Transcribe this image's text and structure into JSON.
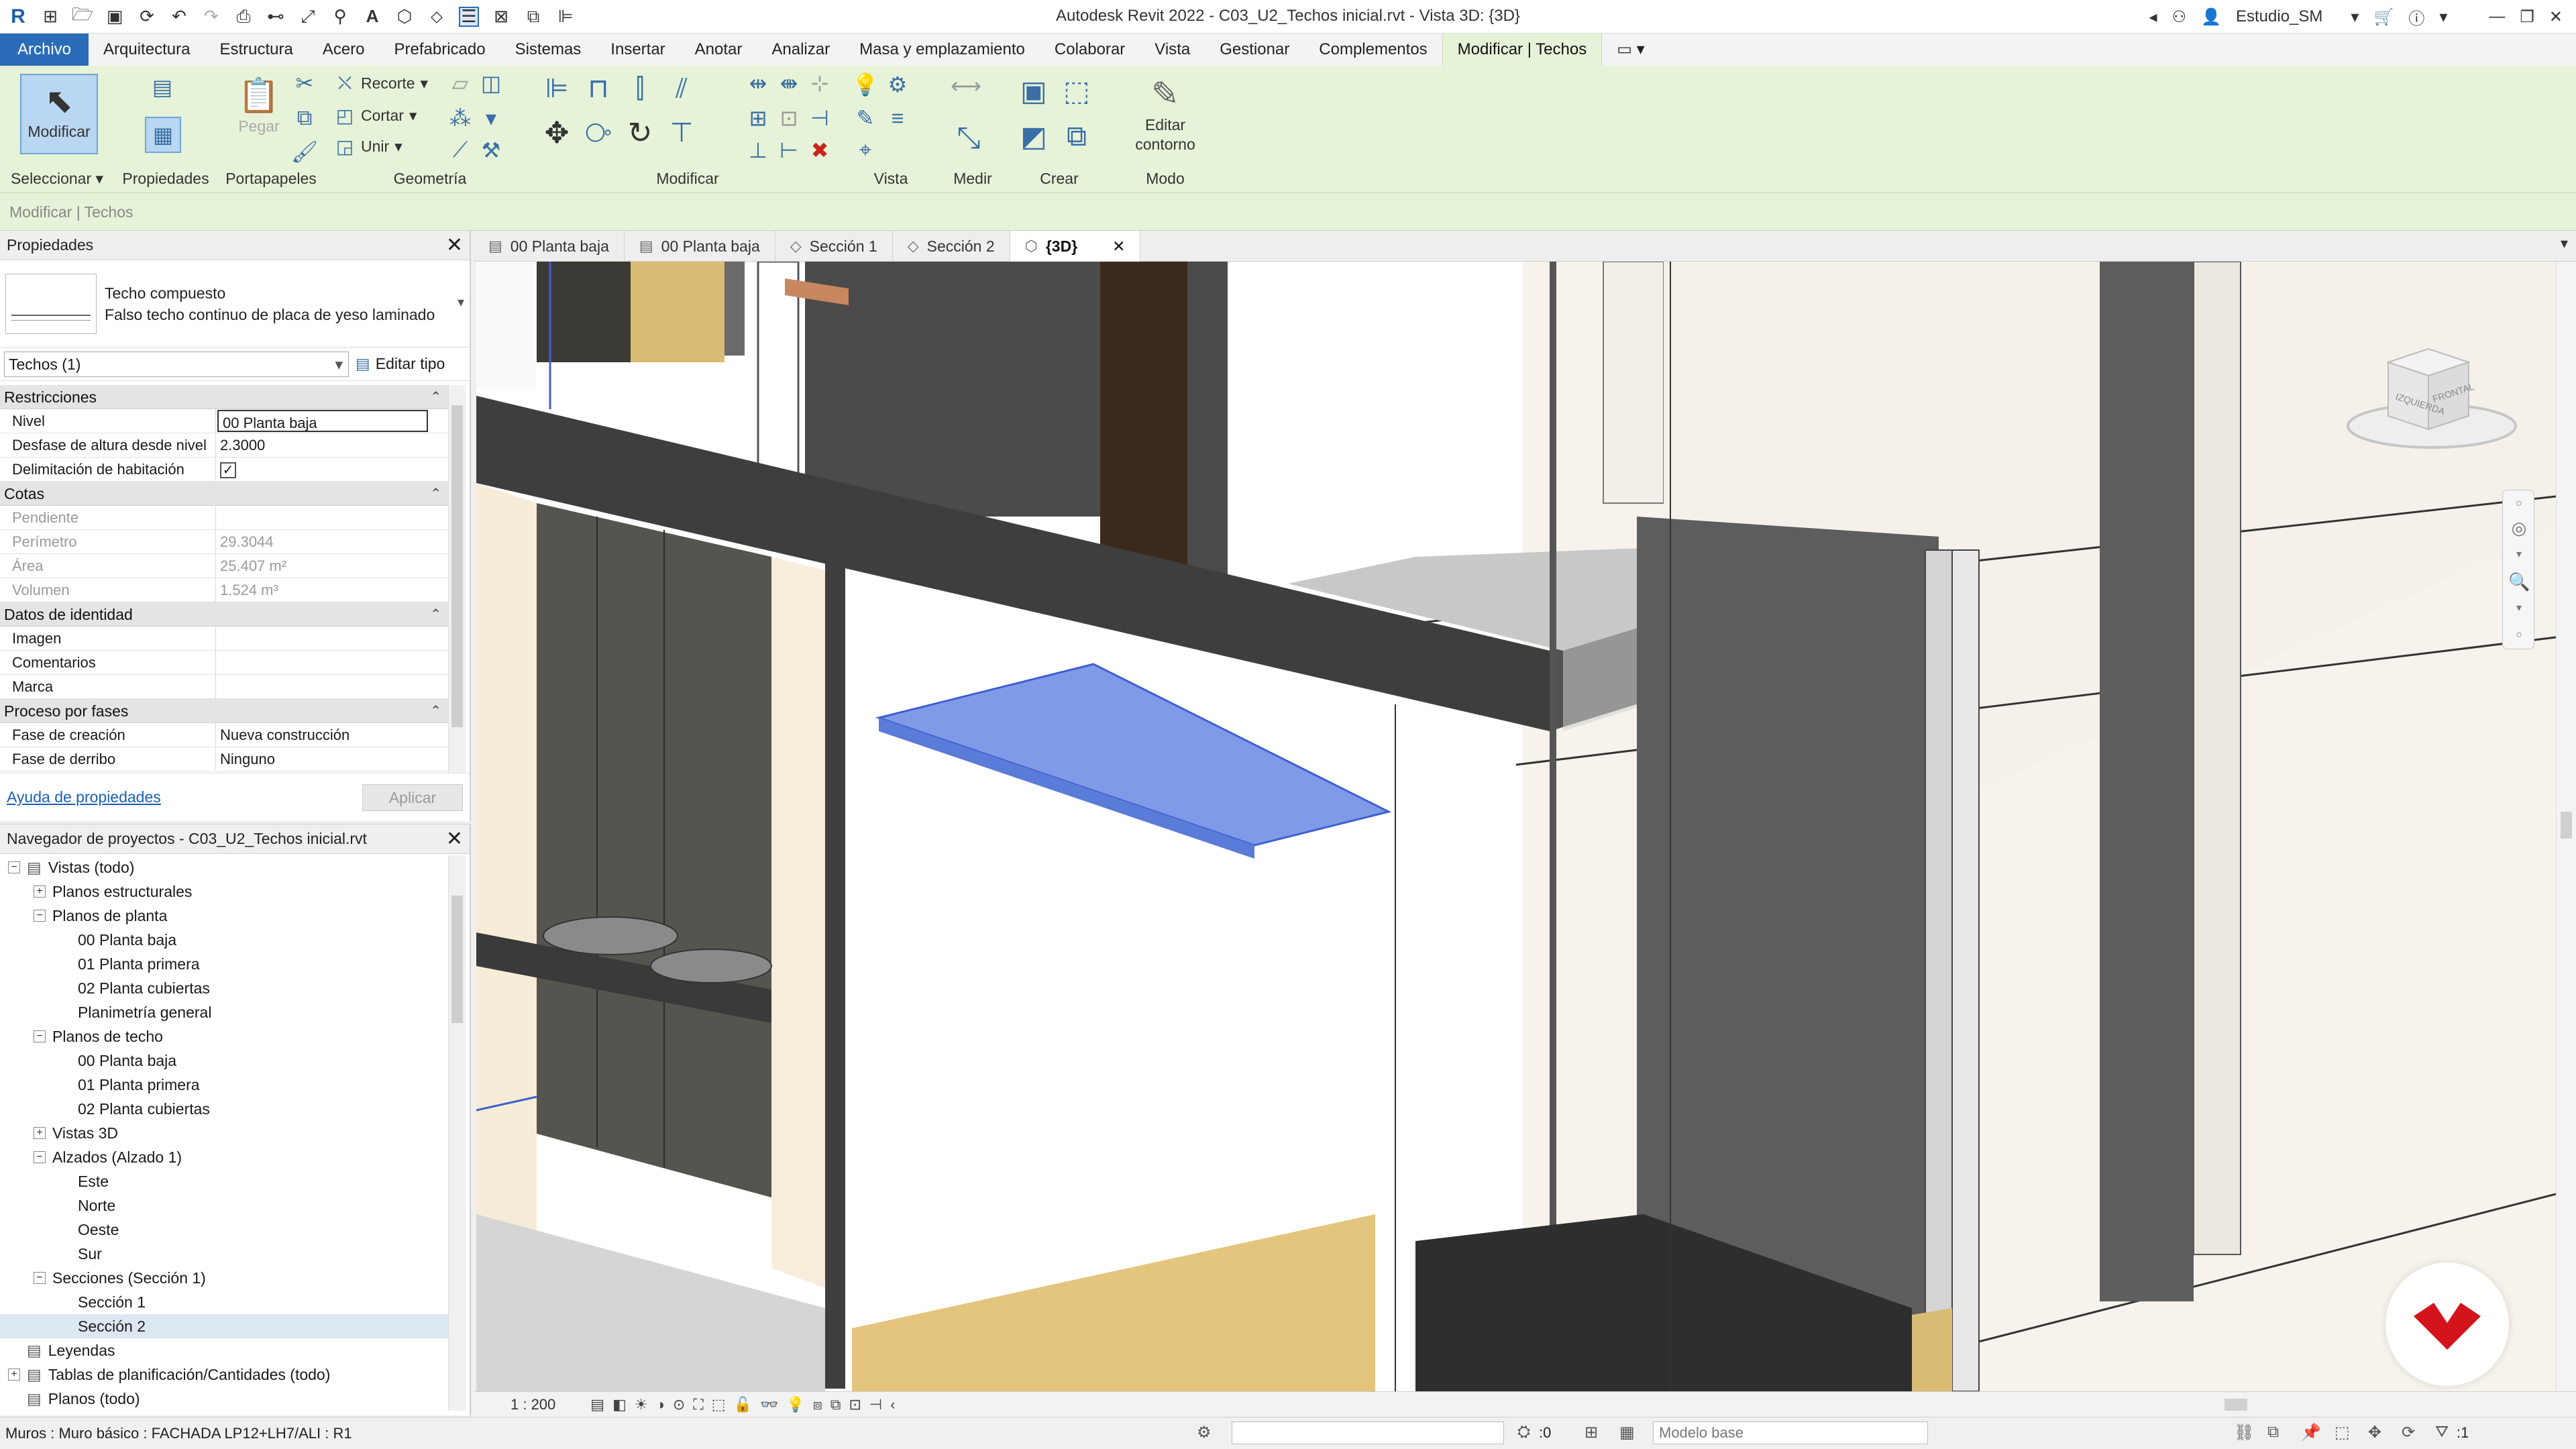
{
  "window": {
    "title": "Autodesk Revit 2022 - C03_U2_Techos inicial.rvt - Vista 3D: {3D}",
    "user": "Estudio_SM"
  },
  "menu": {
    "tabs": [
      "Archivo",
      "Arquitectura",
      "Estructura",
      "Acero",
      "Prefabricado",
      "Sistemas",
      "Insertar",
      "Anotar",
      "Analizar",
      "Masa y emplazamiento",
      "Colaborar",
      "Vista",
      "Gestionar",
      "Complementos",
      "Modificar | Techos"
    ],
    "active": "Modificar | Techos"
  },
  "ribbon": {
    "modify_label": "Modificar",
    "select_label": "Seleccionar",
    "properties_label": "Propiedades",
    "paste_label": "Pegar",
    "clipboard_label": "Portapapeles",
    "cope_label": "Recorte",
    "cut_label": "Cortar",
    "join_label": "Unir",
    "geometry_label": "Geometría",
    "modify_group_label": "Modificar",
    "view_group_label": "Vista",
    "measure_group_label": "Medir",
    "create_group_label": "Crear",
    "edit_boundary_line1": "Editar",
    "edit_boundary_line2": "contorno",
    "mode_group_label": "Modo"
  },
  "context_bar": "Modificar | Techos",
  "properties": {
    "title": "Propiedades",
    "type_family": "Techo compuesto",
    "type_name": "Falso techo continuo de placa de yeso laminado",
    "instance_selector": "Techos (1)",
    "edit_type": "Editar tipo",
    "sections": [
      {
        "name": "Restricciones",
        "rows": [
          {
            "name": "Nivel",
            "value": "00 Planta baja",
            "editing": true
          },
          {
            "name": "Desfase de altura desde nivel",
            "value": "2.3000"
          },
          {
            "name": "Delimitación de habitación",
            "value": "",
            "checkbox": true
          }
        ]
      },
      {
        "name": "Cotas",
        "rows": [
          {
            "name": "Pendiente",
            "value": "",
            "readonly": true
          },
          {
            "name": "Perímetro",
            "value": "29.3044",
            "readonly": true
          },
          {
            "name": "Área",
            "value": "25.407 m²",
            "readonly": true
          },
          {
            "name": "Volumen",
            "value": "1.524 m³",
            "readonly": true
          }
        ]
      },
      {
        "name": "Datos de identidad",
        "rows": [
          {
            "name": "Imagen",
            "value": ""
          },
          {
            "name": "Comentarios",
            "value": ""
          },
          {
            "name": "Marca",
            "value": ""
          }
        ]
      },
      {
        "name": "Proceso por fases",
        "rows": [
          {
            "name": "Fase de creación",
            "value": "Nueva construcción"
          },
          {
            "name": "Fase de derribo",
            "value": "Ninguno"
          }
        ]
      }
    ],
    "help_link": "Ayuda de propiedades",
    "apply": "Aplicar"
  },
  "browser": {
    "title": "Navegador de proyectos - C03_U2_Techos inicial.rvt",
    "nodes": [
      {
        "label": "Vistas (todo)",
        "depth": 0,
        "toggle": "−",
        "icon": true
      },
      {
        "label": "Planos estructurales",
        "depth": 1,
        "toggle": "+"
      },
      {
        "label": "Planos de planta",
        "depth": 1,
        "toggle": "−"
      },
      {
        "label": "00 Planta baja",
        "depth": 2
      },
      {
        "label": "01 Planta primera",
        "depth": 2
      },
      {
        "label": "02 Planta cubiertas",
        "depth": 2
      },
      {
        "label": "Planimetría general",
        "depth": 2
      },
      {
        "label": "Planos de techo",
        "depth": 1,
        "toggle": "−"
      },
      {
        "label": "00 Planta baja",
        "depth": 2
      },
      {
        "label": "01 Planta primera",
        "depth": 2
      },
      {
        "label": "02 Planta cubiertas",
        "depth": 2
      },
      {
        "label": "Vistas 3D",
        "depth": 1,
        "toggle": "+"
      },
      {
        "label": "Alzados (Alzado 1)",
        "depth": 1,
        "toggle": "−"
      },
      {
        "label": "Este",
        "depth": 2
      },
      {
        "label": "Norte",
        "depth": 2
      },
      {
        "label": "Oeste",
        "depth": 2
      },
      {
        "label": "Sur",
        "depth": 2
      },
      {
        "label": "Secciones (Sección 1)",
        "depth": 1,
        "toggle": "−"
      },
      {
        "label": "Sección 1",
        "depth": 2
      },
      {
        "label": "Sección 2",
        "depth": 2,
        "selected": true
      },
      {
        "label": "Leyendas",
        "depth": 0,
        "icon": true
      },
      {
        "label": "Tablas de planificación/Cantidades (todo)",
        "depth": 0,
        "toggle": "+",
        "icon": true
      },
      {
        "label": "Planos (todo)",
        "depth": 0,
        "icon": true
      }
    ]
  },
  "view_tabs": [
    {
      "label": "00 Planta baja",
      "active": false
    },
    {
      "label": "00 Planta baja",
      "active": false
    },
    {
      "label": "Sección 1",
      "active": false
    },
    {
      "label": "Sección 2",
      "active": false
    },
    {
      "label": "{3D}",
      "active": true
    }
  ],
  "viewcube": {
    "face_left": "IZQUIERDA",
    "face_right": "FRONTAL"
  },
  "view_control": {
    "scale": "1 : 200"
  },
  "status": {
    "message": "Muros : Muro básico : FACHADA LP12+LH7/ALI : R1",
    "worksets_count": ":0",
    "model": "Modelo base",
    "filter_count": ":1"
  },
  "colors": {
    "accent": "#2b6cb8",
    "ribbon": "#e6f3d8",
    "selection": "#7f9be8"
  }
}
